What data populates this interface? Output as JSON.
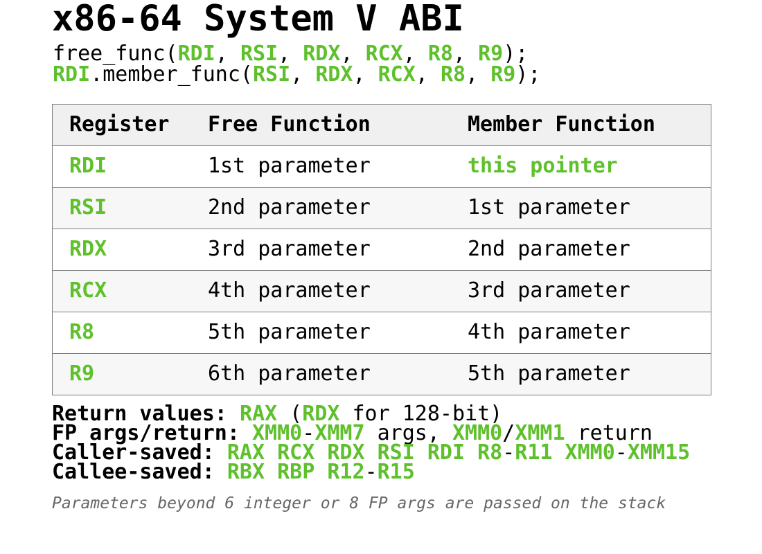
{
  "title": "x86-64 System V ABI",
  "signatures": {
    "free": {
      "fn": "free_func(",
      "r1": "RDI",
      "sep1": ", ",
      "r2": "RSI",
      "sep2": ", ",
      "r3": "RDX",
      "sep3": ", ",
      "r4": "RCX",
      "sep4": ", ",
      "r5": "R8",
      "sep5": ", ",
      "r6": "R9",
      "end": ");"
    },
    "member": {
      "obj": "RDI",
      "fn": ".member_func(",
      "r1": "RSI",
      "sep1": ", ",
      "r2": "RDX",
      "sep2": ", ",
      "r3": "RCX",
      "sep3": ", ",
      "r4": "R8",
      "sep4": ", ",
      "r5": "R9",
      "end": ");"
    }
  },
  "table": {
    "headers": [
      "Register",
      "Free Function",
      "Member Function"
    ],
    "rows": [
      {
        "register": "RDI",
        "free": "1st parameter",
        "member": "this pointer"
      },
      {
        "register": "RSI",
        "free": "2nd parameter",
        "member": "1st parameter"
      },
      {
        "register": "RDX",
        "free": "3rd parameter",
        "member": "2nd parameter"
      },
      {
        "register": "RCX",
        "free": "4th parameter",
        "member": "3rd parameter"
      },
      {
        "register": "R8",
        "free": "5th parameter",
        "member": "4th parameter"
      },
      {
        "register": "R9",
        "free": "6th parameter",
        "member": "5th parameter"
      }
    ]
  },
  "notes": {
    "return": {
      "label": "Return values:",
      "a": "RAX",
      "b": " (",
      "c": "RDX",
      "d": " for 128-bit)"
    },
    "fp": {
      "label": "FP args/return:",
      "a": "XMM0",
      "b": "-",
      "c": "XMM7",
      "d": " args, ",
      "e": "XMM0",
      "f": "/",
      "g": "XMM1",
      "h": " return"
    },
    "caller": {
      "label": "Caller-saved:",
      "a": "RAX RCX RDX RSI RDI R8",
      "b": "-",
      "c": "R11 XMM0",
      "d": "-",
      "e": "XMM15"
    },
    "callee": {
      "label": "Callee-saved:",
      "a": "RBX RBP R12",
      "b": "-",
      "c": "R15"
    }
  },
  "footer": "Parameters beyond 6 integer or 8 FP args are passed on the stack",
  "colors": {
    "accent": "#5ec12c",
    "border": "#7a7a7a",
    "header_bg": "#f0f0f0",
    "alt_row_bg": "#f7f7f7",
    "footer_text": "#666666"
  }
}
